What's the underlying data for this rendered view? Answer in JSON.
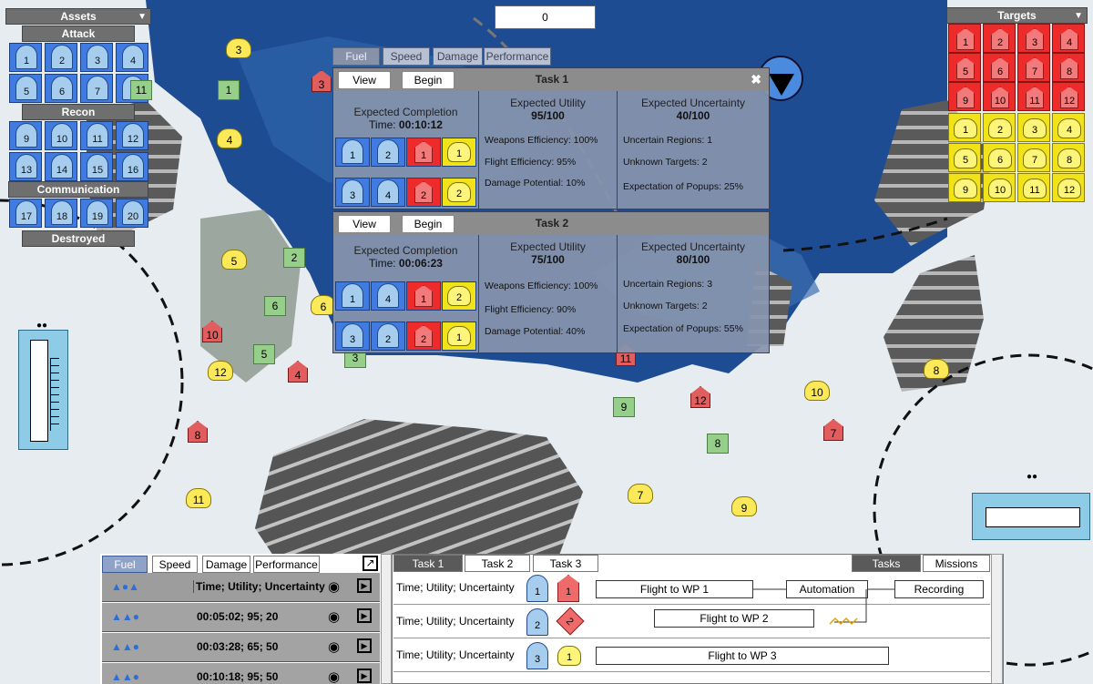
{
  "counter": "0",
  "assets": {
    "title": "Assets",
    "toggle": "▼",
    "attack": "Attack",
    "recon": "Recon",
    "communication": "Communication",
    "destroyed": "Destroyed",
    "attack_ids": [
      "1",
      "2",
      "3",
      "4",
      "5",
      "6",
      "7",
      "8"
    ],
    "recon_ids": [
      "9",
      "10",
      "11",
      "12",
      "13",
      "14",
      "15",
      "16"
    ],
    "comm_ids": [
      "17",
      "18",
      "19",
      "20"
    ]
  },
  "targets": {
    "title": "Targets",
    "toggle": "▼",
    "red": [
      "1",
      "2",
      "3",
      "4",
      "5",
      "6",
      "7",
      "8",
      "9",
      "10",
      "11",
      "12"
    ],
    "yellow": [
      "1",
      "2",
      "3",
      "4",
      "5",
      "6",
      "7",
      "8",
      "9",
      "10",
      "11",
      "12"
    ]
  },
  "popup_tabs": [
    "Fuel",
    "Speed",
    "Damage",
    "Performance"
  ],
  "tasks": [
    {
      "view": "View",
      "begin": "Begin",
      "title": "Task 1",
      "close": "✖",
      "ec_label": "Expected Completion",
      "ec_time_label": "Time:",
      "ec_time": "00:10:12",
      "eu_label": "Expected Utility",
      "eu": "95/100",
      "we": "Weapons Efficiency: 100%",
      "fe": "Flight Efficiency: 95%",
      "dp": "Damage Potential: 10%",
      "unc_label": "Expected Uncertainty",
      "unc": "40/100",
      "ur": "Uncertain Regions: 1",
      "ut": "Unknown Targets: 2",
      "ep": "Expectation of Popups: 25%",
      "row1": [
        "1",
        "2",
        "1",
        "1"
      ],
      "row2": [
        "3",
        "4",
        "2",
        "2"
      ]
    },
    {
      "view": "View",
      "begin": "Begin",
      "title": "Task 2",
      "ec_label": "Expected Completion",
      "ec_time_label": "Time:",
      "ec_time": "00:06:23",
      "eu_label": "Expected Utility",
      "eu": "75/100",
      "we": "Weapons Efficiency: 100%",
      "fe": "Flight Efficiency: 90%",
      "dp": "Damage Potential: 40%",
      "unc_label": "Expected Uncertainty",
      "unc": "80/100",
      "ur": "Uncertain Regions: 3",
      "ut": "Unknown Targets: 2",
      "ep": "Expectation of Popups: 55%",
      "row1": [
        "1",
        "4",
        "1",
        "2"
      ],
      "row2": [
        "3",
        "2",
        "2",
        "1"
      ]
    }
  ],
  "map": {
    "green": [
      "1",
      "2",
      "6",
      "5",
      "3",
      "9",
      "8",
      "11"
    ],
    "yellow": [
      "3",
      "4",
      "5",
      "6",
      "12",
      "11",
      "7",
      "9",
      "10",
      "8"
    ],
    "red": [
      "3",
      "10",
      "4",
      "8",
      "12",
      "7",
      "11"
    ]
  },
  "bottom_left": {
    "tabs": [
      "Fuel",
      "Speed",
      "Damage",
      "Performance"
    ],
    "header": "Time; Utility; Uncertainty",
    "rows": [
      "00:05:02; 95; 20",
      "00:03:28; 65; 50",
      "00:10:18; 95; 50"
    ]
  },
  "bottom_right": {
    "tabs": [
      "Task 1",
      "Task 2",
      "Task 3"
    ],
    "right_tabs": [
      "Tasks",
      "Missions"
    ],
    "row_label": "Time; Utility; Uncertainty",
    "rows": [
      {
        "asset": "1",
        "target": "1"
      },
      {
        "asset": "2",
        "target": "2"
      },
      {
        "asset": "3",
        "target": "1"
      }
    ],
    "flight1": "Flight to WP 1",
    "automation": "Automation",
    "recording": "Recording",
    "flight2": "Flight to WP 2",
    "flight3": "Flight to WP 3"
  }
}
